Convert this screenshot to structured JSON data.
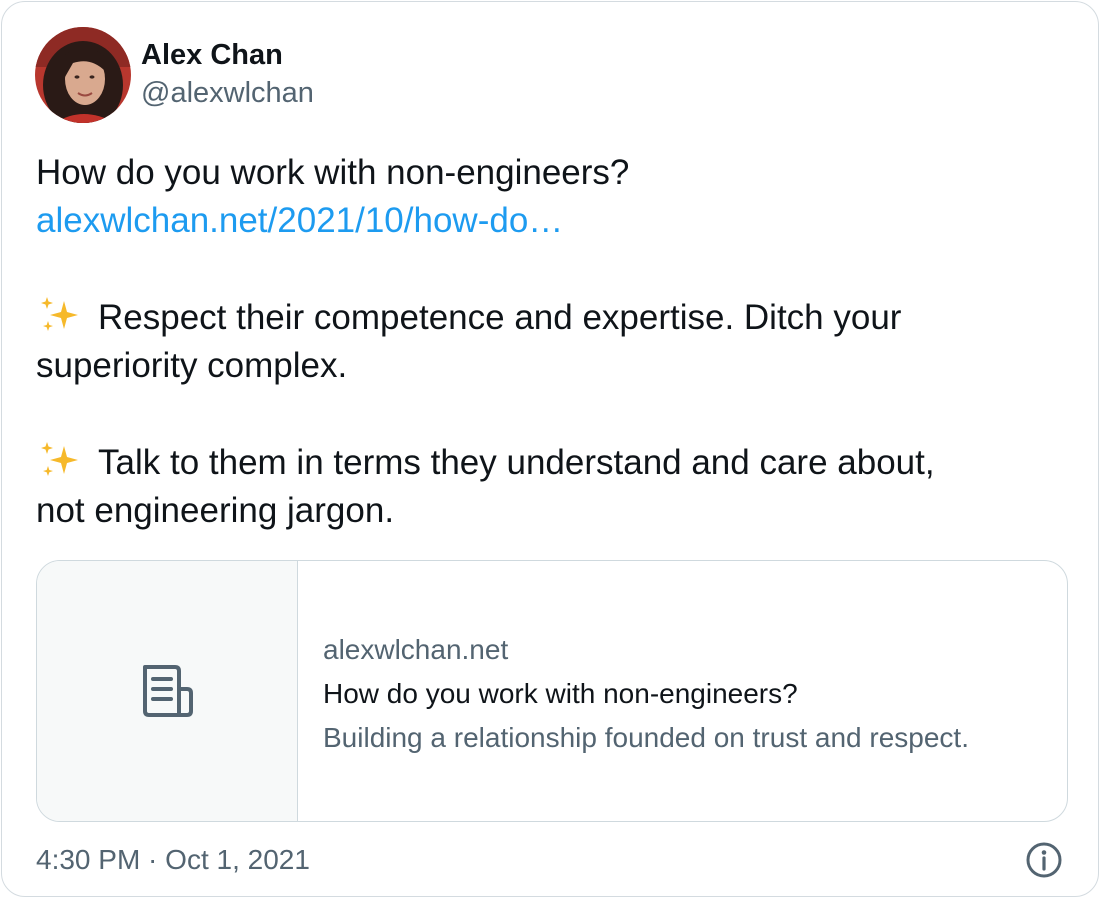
{
  "author": {
    "display_name": "Alex Chan",
    "handle": "@alexwlchan"
  },
  "tweet": {
    "line1": "How do you work with non-engineers?",
    "link_text": "alexwlchan.net/2021/10/how-do…",
    "point1_emoji": "sparkles-icon",
    "point1_line1": "Respect their competence and expertise. Ditch your",
    "point1_line2": "superiority complex.",
    "point2_emoji": "sparkles-icon",
    "point2_line1": "Talk to them in terms they understand and care about,",
    "point2_line2": "not engineering jargon."
  },
  "card": {
    "icon": "article-icon",
    "domain": "alexwlchan.net",
    "title": "How do you work with non-engineers?",
    "description": "Building a relationship founded on trust and respect."
  },
  "footer": {
    "timestamp": "4:30 PM · Oct 1, 2021",
    "info_icon": "info-icon"
  },
  "colors": {
    "link": "#1d9bf0",
    "secondary_text": "#536471",
    "primary_text": "#0f1419",
    "border": "#cfd9de",
    "sparkle": "#f6b92b"
  }
}
